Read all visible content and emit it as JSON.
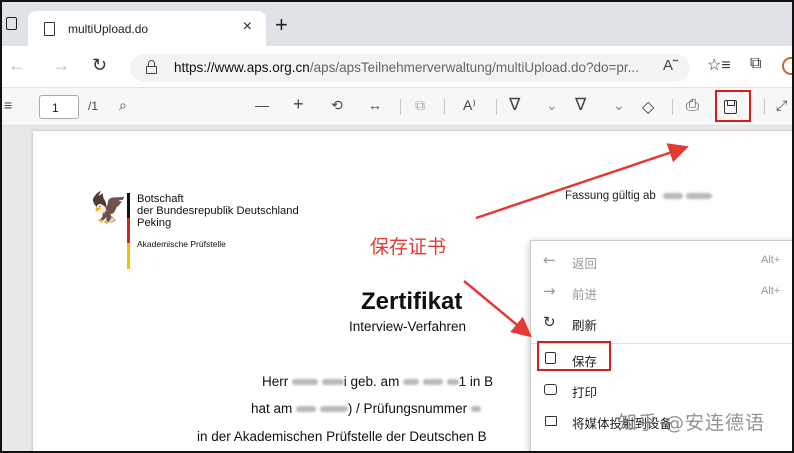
{
  "browser": {
    "tab_title": "multiUpload.do",
    "tab_close": "×",
    "new_tab": "+",
    "url_domain": "https://www.aps.org.cn",
    "url_path": "/aps/apsTeilnehmerverwaltung/multiUpload.do?do=pr...",
    "read_aloud_icon": "A˜"
  },
  "pdf_toolbar": {
    "menu_icon": "≡",
    "page_current": "1",
    "page_total": "/1",
    "search_icon": "⌕",
    "zoom_out": "—",
    "zoom_in": "+",
    "rotate_icon": "⟲",
    "fit_icon": "↔",
    "pageview_icon": "⧉",
    "read_aloud": "A⁾",
    "draw_icon": "∇",
    "dropdown1": "⌄",
    "highlight_icon": "∇",
    "dropdown2": "⌄",
    "eraser_icon": "◇",
    "print_icon": "⎙",
    "expand_icon": "⤢"
  },
  "document": {
    "embassy_line1": "Botschaft",
    "embassy_line2": "der Bundesrepublik Deutschland",
    "embassy_line3": "Peking",
    "embassy_line4": "Akademische Prüfstelle",
    "fassung": "Fassung gültig ab",
    "title": "Zertifikat",
    "subtitle": "Interview-Verfahren",
    "line1_a": "Herr",
    "line1_b": "i geb. am",
    "line1_c": "1 in B",
    "line2_a": "hat am",
    "line2_b": ") / Prüfungsnummer",
    "line3": "in der Akademischen Prüfstelle der Deutschen B"
  },
  "annotation": {
    "save_note": "保存证书",
    "arrow_color": "#e53935",
    "highlight_color": "#d81b1b"
  },
  "context_menu": {
    "items": [
      {
        "icon": "←",
        "label": "返回",
        "shortcut": "Alt+"
      },
      {
        "icon": "→",
        "label": "前进",
        "shortcut": "Alt+"
      },
      {
        "icon": "↻",
        "label": "刷新",
        "shortcut": ""
      },
      {
        "icon": "",
        "label": "保存",
        "shortcut": ""
      },
      {
        "icon": "",
        "label": "打印",
        "shortcut": ""
      },
      {
        "icon": "",
        "label": "将媒体投射到设备",
        "shortcut": ""
      }
    ]
  },
  "watermark": "知乎 @安连德语"
}
